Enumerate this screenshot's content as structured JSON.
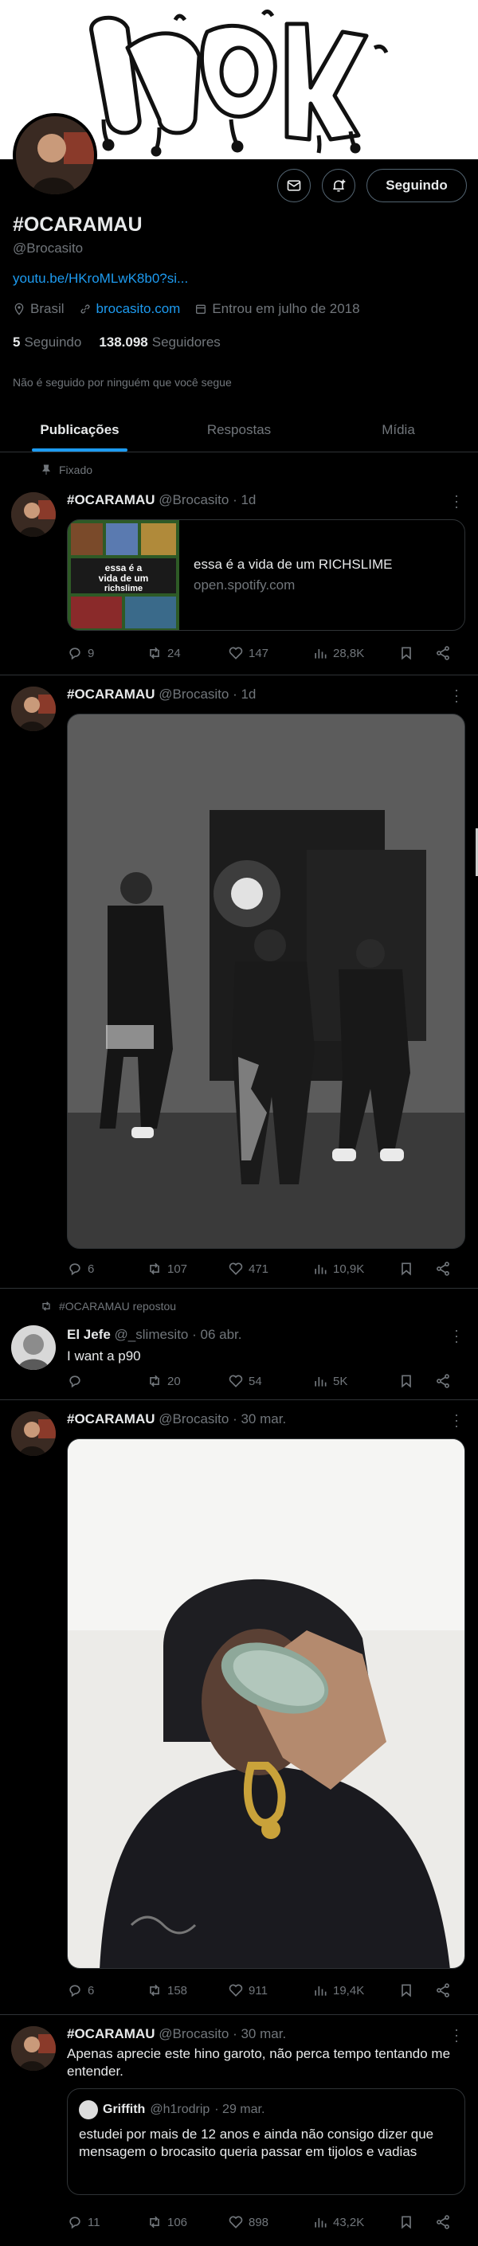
{
  "profile": {
    "display_name": "#OCARAMAU",
    "handle": "@Brocasito",
    "bio_link": "youtu.be/HKroMLwK8b0?si...",
    "location": "Brasil",
    "website": "brocasito.com",
    "joined": "Entrou em julho de 2018",
    "following_count": "5",
    "following_label": "Seguindo",
    "followers_count": "138.098",
    "followers_label": "Seguidores",
    "followed_note": "Não é seguido por ninguém que você segue",
    "follow_button": "Seguindo"
  },
  "tabs": [
    {
      "label": "Publicações",
      "active": true
    },
    {
      "label": "Respostas",
      "active": false
    },
    {
      "label": "Mídia",
      "active": false
    }
  ],
  "colors": {
    "accent": "#1d9bf0",
    "muted": "#71767b",
    "border": "#2f3336",
    "background": "#000000"
  },
  "tweets": [
    {
      "context": "Fixado",
      "name": "#OCARAMAU",
      "handle": "@Brocasito",
      "time": "· 1d",
      "card": {
        "title": "essa é a vida de um RICHSLIME",
        "domain": "open.spotify.com",
        "thumb_text_1": "essa é a",
        "thumb_text_2": "vida de um",
        "thumb_text_3": "richslime"
      },
      "replies": "9",
      "reposts": "24",
      "likes": "147",
      "views": "28,8K"
    },
    {
      "name": "#OCARAMAU",
      "handle": "@Brocasito",
      "time": "· 1d",
      "replies": "6",
      "reposts": "107",
      "likes": "471",
      "views": "10,9K"
    },
    {
      "context": "#OCARAMAU repostou",
      "name": "El Jefe",
      "handle": "@_slimesito",
      "time": "· 06 abr.",
      "text": "I want a p90",
      "replies": "",
      "reposts": "20",
      "likes": "54",
      "views": "5K"
    },
    {
      "name": "#OCARAMAU",
      "handle": "@Brocasito",
      "time": "· 30 mar.",
      "replies": "6",
      "reposts": "158",
      "likes": "911",
      "views": "19,4K"
    },
    {
      "name": "#OCARAMAU",
      "handle": "@Brocasito",
      "time": "· 30 mar.",
      "text": "Apenas aprecie este hino garoto, não perca tempo tentando me entender.",
      "quote": {
        "name": "Griffith",
        "handle": "@h1rodrip",
        "time": "· 29 mar.",
        "text": "estudei por mais de 12 anos e ainda não consigo dizer que mensagem o brocasito queria passar em tijolos e vadias"
      },
      "replies": "11",
      "reposts": "106",
      "likes": "898",
      "views": "43,2K"
    }
  ]
}
